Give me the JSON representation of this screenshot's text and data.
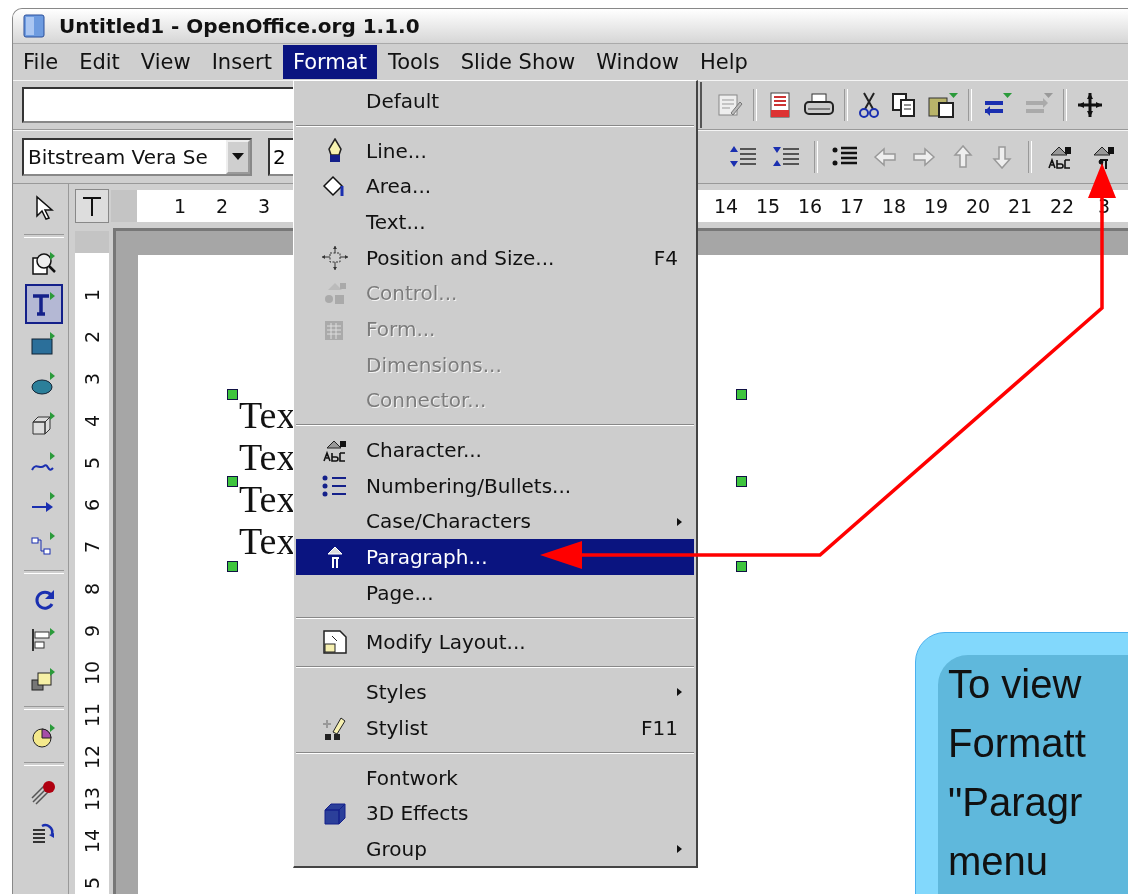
{
  "window": {
    "title": "Untitled1 - OpenOffice.org 1.1.0"
  },
  "menu_bar": [
    {
      "label": "File",
      "selected": false
    },
    {
      "label": "Edit",
      "selected": false
    },
    {
      "label": "View",
      "selected": false
    },
    {
      "label": "Insert",
      "selected": false
    },
    {
      "label": "Format",
      "selected": true
    },
    {
      "label": "Tools",
      "selected": false
    },
    {
      "label": "Slide Show",
      "selected": false
    },
    {
      "label": "Window",
      "selected": false
    },
    {
      "label": "Help",
      "selected": false
    }
  ],
  "font_toolbar": {
    "font_name": "Bitstream Vera Se",
    "font_size": "2"
  },
  "tool_groups": [
    {
      "tools": [
        {
          "kind": "select",
          "selected": false
        }
      ]
    },
    {
      "tools": [
        {
          "kind": "zoom",
          "selected": false
        },
        {
          "kind": "text",
          "selected": true
        },
        {
          "kind": "rectangle",
          "selected": false
        },
        {
          "kind": "ellipse",
          "selected": false
        },
        {
          "kind": "cube",
          "selected": false
        },
        {
          "kind": "curve",
          "selected": false
        },
        {
          "kind": "line-arrow",
          "selected": false
        },
        {
          "kind": "connector",
          "selected": false
        }
      ]
    },
    {
      "tools": [
        {
          "kind": "rotate",
          "selected": false
        },
        {
          "kind": "align",
          "selected": false
        },
        {
          "kind": "arrange",
          "selected": false
        }
      ]
    },
    {
      "tools": [
        {
          "kind": "chart",
          "selected": false
        }
      ]
    },
    {
      "tools": [
        {
          "kind": "effects",
          "selected": false
        },
        {
          "kind": "interaction",
          "selected": false
        }
      ]
    }
  ],
  "horizontal_ruler": {
    "left_numbers": [
      "1",
      "2",
      "3"
    ],
    "right_numbers": [
      "14",
      "15",
      "16",
      "17",
      "18",
      "19",
      "20",
      "21",
      "22",
      "3"
    ]
  },
  "vertical_ruler": {
    "numbers": [
      "1",
      "2",
      "3",
      "4",
      "5",
      "6",
      "7",
      "8",
      "9",
      "10",
      "11",
      "12",
      "13",
      "14",
      "5"
    ]
  },
  "slide": {
    "text_lines": [
      "Tex",
      "Tex",
      "Tex",
      "Tex"
    ]
  },
  "format_menu": [
    {
      "kind": "item",
      "label": "Default",
      "disabled": false,
      "selected": false,
      "submenu": false
    },
    {
      "kind": "separator"
    },
    {
      "kind": "item",
      "label": "Line...",
      "disabled": false,
      "selected": false,
      "submenu": false
    },
    {
      "kind": "item",
      "label": "Area...",
      "disabled": false,
      "selected": false,
      "submenu": false
    },
    {
      "kind": "item",
      "label": "Text...",
      "disabled": false,
      "selected": false,
      "submenu": false
    },
    {
      "kind": "item",
      "label": "Position and Size...",
      "shortcut": "F4",
      "disabled": false,
      "selected": false,
      "submenu": false
    },
    {
      "kind": "item",
      "label": "Control...",
      "disabled": true,
      "selected": false,
      "submenu": false
    },
    {
      "kind": "item",
      "label": "Form...",
      "disabled": true,
      "selected": false,
      "submenu": false
    },
    {
      "kind": "item",
      "label": "Dimensions...",
      "disabled": true,
      "selected": false,
      "submenu": false
    },
    {
      "kind": "item",
      "label": "Connector...",
      "disabled": true,
      "selected": false,
      "submenu": false
    },
    {
      "kind": "separator"
    },
    {
      "kind": "item",
      "label": "Character...",
      "disabled": false,
      "selected": false,
      "submenu": false
    },
    {
      "kind": "item",
      "label": "Numbering/Bullets...",
      "disabled": false,
      "selected": false,
      "submenu": false
    },
    {
      "kind": "item",
      "label": "Case/Characters",
      "disabled": false,
      "selected": false,
      "submenu": true
    },
    {
      "kind": "item",
      "label": "Paragraph...",
      "disabled": false,
      "selected": true,
      "submenu": false
    },
    {
      "kind": "item",
      "label": "Page...",
      "disabled": false,
      "selected": false,
      "submenu": false
    },
    {
      "kind": "separator"
    },
    {
      "kind": "item",
      "label": "Modify Layout...",
      "disabled": false,
      "selected": false,
      "submenu": false
    },
    {
      "kind": "separator"
    },
    {
      "kind": "item",
      "label": "Styles",
      "disabled": false,
      "selected": false,
      "submenu": true
    },
    {
      "kind": "item",
      "label": "Stylist",
      "shortcut": "F11",
      "disabled": false,
      "selected": false,
      "submenu": false
    },
    {
      "kind": "separator"
    },
    {
      "kind": "item",
      "label": "Fontwork",
      "disabled": false,
      "selected": false,
      "submenu": false
    },
    {
      "kind": "item",
      "label": "3D Effects",
      "disabled": false,
      "selected": false,
      "submenu": false
    },
    {
      "kind": "item",
      "label": "Group",
      "disabled": false,
      "selected": false,
      "submenu": true
    }
  ],
  "callout": {
    "lines": [
      "To view",
      "Formatt",
      "\"Paragr",
      "menu"
    ]
  }
}
